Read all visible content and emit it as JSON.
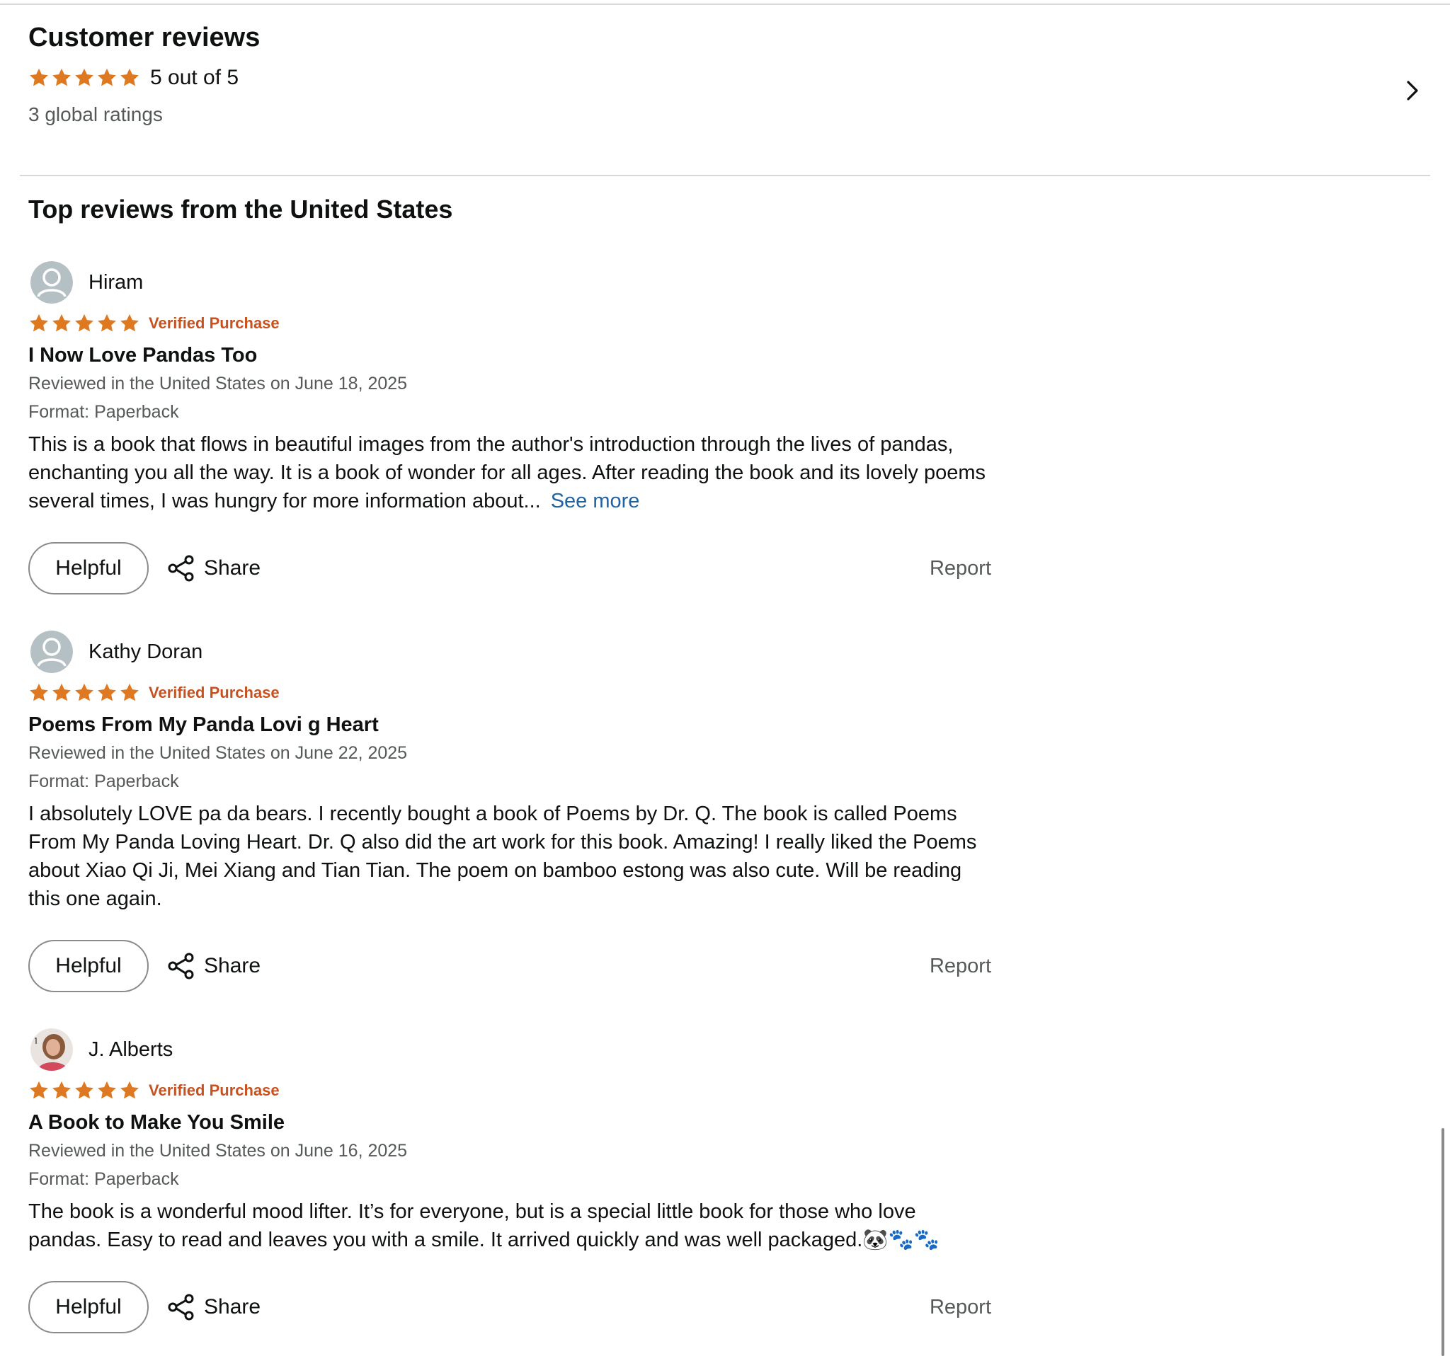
{
  "summary": {
    "title": "Customer reviews",
    "rating_text": "5 out of 5",
    "stars": 5,
    "global_ratings": "3 global ratings"
  },
  "top_reviews": {
    "title": "Top reviews from the United States"
  },
  "labels": {
    "verified": "Verified Purchase",
    "helpful": "Helpful",
    "share": "Share",
    "report": "Report",
    "see_more": "See more"
  },
  "colors": {
    "star": "#de7921",
    "verified": "#c7511f",
    "link": "#2162a1",
    "secondary_text": "#565959"
  },
  "reviews": [
    {
      "reviewer": "Hiram",
      "stars": 5,
      "title": "I Now Love Pandas Too",
      "date": "Reviewed in the United States on June 18, 2025",
      "format": "Format: Paperback",
      "body": "This is a book that flows in beautiful images from the author's introduction through the lives of pandas, enchanting you all the way. It is a book of wonder for all ages. After reading the book and its lovely poems several times, I was hungry for more information about...",
      "avatar": "default-avatar-icon"
    },
    {
      "reviewer": "Kathy Doran",
      "stars": 5,
      "title": "Poems From My Panda Lovi g Heart",
      "date": "Reviewed in the United States on June 22, 2025",
      "format": "Format: Paperback",
      "body": "I absolutely LOVE pa da bears. I recently bought a book of Poems by Dr. Q. The book is called Poems From My Panda Loving Heart. Dr. Q also did the art work for this book. Amazing! I really liked the Poems about Xiao Qi Ji, Mei Xiang and Tian Tian. The poem on bamboo estong was also cute. Will be reading this one again.",
      "avatar": "default-avatar-icon"
    },
    {
      "reviewer": "J. Alberts",
      "stars": 5,
      "title": "A Book to Make You Smile",
      "date": "Reviewed in the United States on June 16, 2025",
      "format": "Format: Paperback",
      "body": "The book is a wonderful mood lifter. It’s for everyone, but is a special little book for those who love pandas. Easy to read and leaves you with a smile. It arrived quickly and was well packaged.🐼🐾🐾",
      "avatar": "photo-avatar-icon"
    }
  ]
}
